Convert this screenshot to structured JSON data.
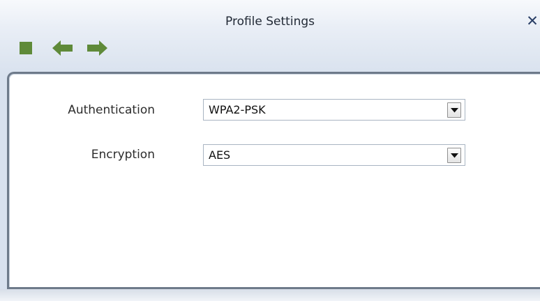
{
  "window": {
    "title": "Profile Settings",
    "close_symbol": "✕"
  },
  "toolbar": {
    "items": [
      {
        "icon": "stop-icon",
        "color": "#5f8a39"
      },
      {
        "icon": "back-arrow-icon",
        "color": "#5f8a39"
      },
      {
        "icon": "forward-arrow-icon",
        "color": "#5f8a39"
      }
    ]
  },
  "form": {
    "authentication": {
      "label": "Authentication",
      "value": "WPA2-PSK"
    },
    "encryption": {
      "label": "Encryption",
      "value": "AES"
    }
  }
}
